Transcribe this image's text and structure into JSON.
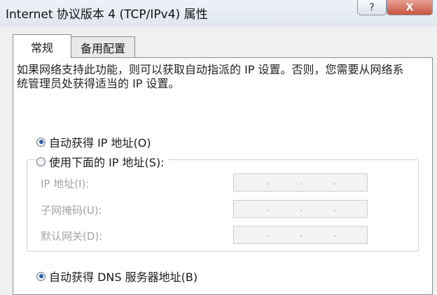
{
  "window": {
    "title": "Internet 协议版本 4 (TCP/IPv4) 属性",
    "help_label": "?",
    "close_label": "X"
  },
  "tabs": [
    {
      "label": "常规",
      "selected": true
    },
    {
      "label": "备用配置",
      "selected": false
    }
  ],
  "general": {
    "description": "如果网络支持此功能，则可以获取自动指派的 IP 设置。否则，您需要从网络系统管理员处获得适当的 IP 设置。",
    "ip_mode": {
      "auto": {
        "label": "自动获得 IP 地址(O)",
        "checked": true
      },
      "manual": {
        "label": "使用下面的 IP 地址(S):",
        "checked": false
      }
    },
    "fields": [
      {
        "label": "IP 地址(I):",
        "value": ". . ."
      },
      {
        "label": "子网掩码(U):",
        "value": ". . ."
      },
      {
        "label": "默认网关(D):",
        "value": ". . ."
      }
    ],
    "dns_mode": {
      "auto": {
        "label": "自动获得 DNS 服务器地址(B)",
        "checked": true
      }
    }
  }
}
